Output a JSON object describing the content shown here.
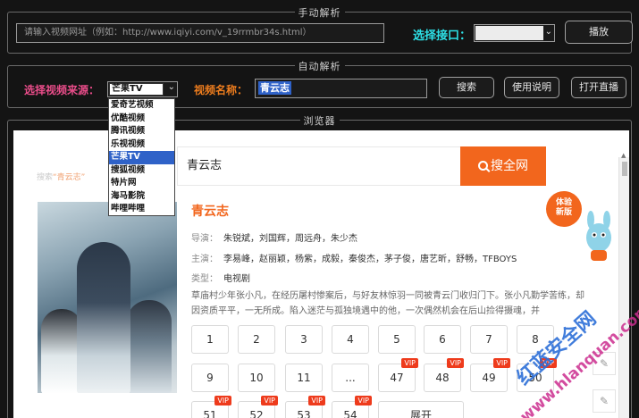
{
  "manual": {
    "group_title": "手动解析",
    "url_placeholder": "请输入视频网址（例如：http://www.iqiyi.com/v_19rrmbr34s.html）",
    "interface_label": "选择接口：",
    "play_button": "播放"
  },
  "auto": {
    "group_title": "自动解析",
    "source_label": "选择视频来源：",
    "source_selected": "芒果TV",
    "name_label": "视频名称：",
    "name_value": "青云志",
    "search_button": "搜索",
    "help_button": "使用说明",
    "live_button": "打开直播"
  },
  "source_options": [
    "爱奇艺视频",
    "优酷视频",
    "腾讯视频",
    "乐视视频",
    "芒果TV",
    "搜狐视频",
    "特片网",
    "海马影院",
    "哔哩哔哩"
  ],
  "source_active_index": 4,
  "browser": {
    "group_title": "浏览器",
    "search_text": "青云志",
    "search_button": "搜全网",
    "hint_prefix": "搜索",
    "hint_query": "“青云志”",
    "badge_line1": "体验",
    "badge_line2": "新版",
    "show": {
      "title": "青云志",
      "director_key": "导演：",
      "director_value": "朱锐斌，刘国辉，周远舟，朱少杰",
      "cast_key": "主演：",
      "cast_value": "李易峰，赵丽颖，杨紫，成毅，秦俊杰，茅子俊，唐艺昕，舒畅，TFBOYS",
      "type_key": "类型：",
      "type_value": "电视剧",
      "description": "草庙村少年张小凡，在经历屠村惨案后，与好友林惊羽一同被青云门收归门下。张小凡勤学苦练，却因资质平平，一无所成。陷入迷茫与孤独境遇中的他，一次偶然机会在后山捡得摄魂，并"
    },
    "episodes": [
      {
        "label": "1",
        "vip": false
      },
      {
        "label": "2",
        "vip": false
      },
      {
        "label": "3",
        "vip": false
      },
      {
        "label": "4",
        "vip": false
      },
      {
        "label": "5",
        "vip": false
      },
      {
        "label": "6",
        "vip": false
      },
      {
        "label": "7",
        "vip": false
      },
      {
        "label": "8",
        "vip": false
      },
      {
        "label": "9",
        "vip": false
      },
      {
        "label": "10",
        "vip": false
      },
      {
        "label": "11",
        "vip": false
      },
      {
        "label": "...",
        "vip": false
      },
      {
        "label": "47",
        "vip": true
      },
      {
        "label": "48",
        "vip": true
      },
      {
        "label": "49",
        "vip": true
      },
      {
        "label": "50",
        "vip": true
      },
      {
        "label": "51",
        "vip": true
      },
      {
        "label": "52",
        "vip": true
      },
      {
        "label": "53",
        "vip": true
      },
      {
        "label": "54",
        "vip": true
      },
      {
        "label": "展开",
        "vip": false
      }
    ],
    "vip_label": "VIP"
  },
  "watermark": {
    "line1": "红蓝安全网",
    "line2": "www.hlanquan.com"
  },
  "colors": {
    "cyan": "#2de0e6",
    "pink": "#ea4d8a",
    "orange": "#ee7d1e",
    "search_orange": "#f2661d",
    "selection_blue": "#2f62c8"
  }
}
